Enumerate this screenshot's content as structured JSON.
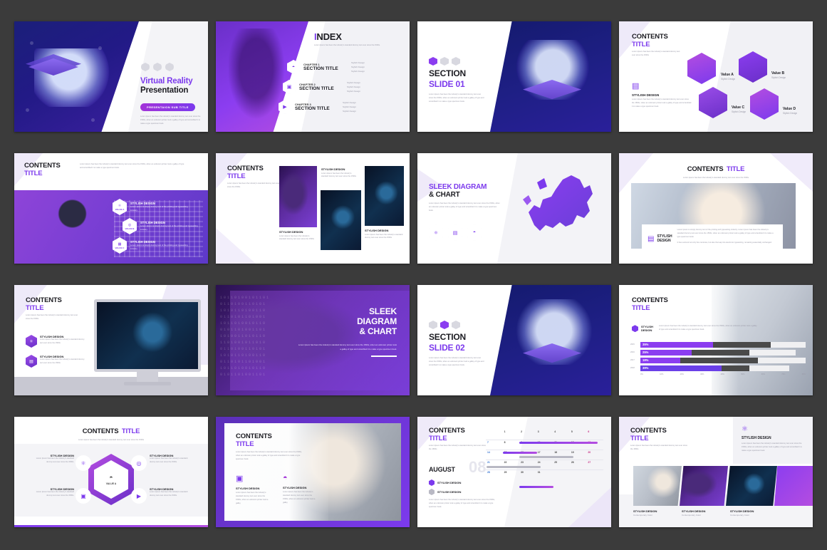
{
  "deck": {
    "theme_colors": {
      "purple": "#7c3aed",
      "violet": "#8b3df0",
      "navy": "#1b1f7a",
      "dark_bg": "#3b3b3b",
      "magenta": "#a233d8"
    },
    "lorem_short": "Lorem Ipsum has been the industry's standard dummy text ever since the 1500s.",
    "lorem_medium": "Lorem Ipsum has been the industry's standard dummy text ever since the 1500s, when an unknown printer took a galley of type and scrambled it to make a type specimen book.",
    "lorem_long": "Lorem Ipsum is simply dummy text of the printing and typesetting industry. Lorem Ipsum has been the industry's standard dummy text ever since the 1500s, when an unknown printer took a galley of type and scrambled it to make a type specimen book.",
    "lorem_extra": "It has survived not only five centuries, but also the leap into electronic typesetting, remaining essentially unchanged.",
    "lorem_tiny": "Lorem Ipsum is simply dummy text of the printing and typesetting industry."
  },
  "slides": [
    {
      "id": 1,
      "name": "title-slide",
      "title_line1": "Virtual Reality",
      "title_line2": "Presentation",
      "badge": "PRESENTAION SUB TITLE",
      "body": "Lorem Ipsum has been the industry's standard dummy text ever since the 1500s, when an unknown printer took a galley of type and scrambled it to make a type specimen book.",
      "icons": [
        "hexagon-icon",
        "vr-headset-icon",
        "gear-icon"
      ]
    },
    {
      "id": 2,
      "name": "index-slide",
      "title": "INDEX",
      "subtitle": "Lorem Ipsum has been the industry's standard dummy text ever since the 1500s.",
      "chapters": [
        {
          "label": "CHAPTER 1",
          "title": "SECTION TITLE",
          "icon": "vr-goggles-icon",
          "bullets": [
            "Stylish Design",
            "Stylish Design",
            "Stylish Design"
          ]
        },
        {
          "label": "CHAPTER 2",
          "title": "SECTION TITLE",
          "icon": "camera-icon",
          "bullets": [
            "Stylish Design",
            "Stylish Design",
            "Stylish Design"
          ]
        },
        {
          "label": "CHAPTER 3",
          "title": "SECTION TITLE",
          "icon": "play-icon",
          "bullets": [
            "Stylish Design",
            "Stylish Design",
            "Stylish Design"
          ]
        }
      ]
    },
    {
      "id": 3,
      "name": "section-slide-01",
      "title_line1": "SECTION",
      "title_line2": "SLIDE 01",
      "body": "Lorem Ipsum has been the industry's standard dummy text ever since the 1500s, when an unknown printer took a galley of type and scrambled it to make a type specimen book.",
      "icons": [
        "vr-headset-icon",
        "hexagon-icon",
        "gear-icon"
      ],
      "active_icon_index": 0
    },
    {
      "id": 4,
      "name": "contents-hex-values",
      "title_line1": "CONTENTS",
      "title_line2": "TITLE",
      "subtitle": "Lorem Ipsum has been the industry's standard dummy text ever since the 1500s",
      "feature_label": "STYLISH DESIGN",
      "feature_icon": "vr-box-icon",
      "feature_body": "Lorem Ipsum has been the industry's standard dummy text ever since the 1500s, when an unknown printer took a galley of type and scrambled it to make a type specimen book.",
      "values": [
        {
          "label": "Value A",
          "sub": "Stylish Design"
        },
        {
          "label": "Value B",
          "sub": "Stylish Design"
        },
        {
          "label": "Value C",
          "sub": "Stylish Design"
        },
        {
          "label": "Value D",
          "sub": "Stylish Design"
        }
      ]
    },
    {
      "id": 5,
      "name": "contents-vr-woman",
      "title_line1": "CONTENTS",
      "title_line2": "TITLE",
      "body": "Lorem Ipsum has been the industry's standard dummy text ever since the 1500s, when an unknown printer took a galley of type and scrambled it to make a type specimen book.",
      "items": [
        {
          "badge": "VALUE A",
          "icon": "atom-icon",
          "title": "STYLISH DESIGN",
          "body": "Lorem Ipsum is simply dummy text of the printing and typesetting industry."
        },
        {
          "badge": "VALUE B",
          "icon": "target-icon",
          "title": "STYLISH DESIGN",
          "body": "Lorem Ipsum is simply dummy text of the printing and typesetting industry."
        },
        {
          "badge": "VALUE C",
          "icon": "image-icon",
          "title": "STYLISH DESIGN",
          "body": "Lorem Ipsum is simply dummy text of the printing and typesetting industry."
        }
      ]
    },
    {
      "id": 6,
      "name": "contents-three-photos",
      "title_line1": "CONTENTS",
      "title_line2": "TITLE",
      "subtitle": "Lorem Ipsum has been the industry's standard dummy text ever since the 1500s",
      "cards": [
        {
          "title": "STYLISH DESIGN",
          "body": "Lorem Ipsum has been the industry's standard dummy text ever since the 1500s"
        },
        {
          "title": "STYLISH DESIGN",
          "body": "Lorem Ipsum has been the industry's standard dummy text ever since the 1500s"
        },
        {
          "title": "STYLISH DESIGN",
          "body": "Lorem Ipsum has been the industry's standard dummy text ever since the 1500s"
        }
      ]
    },
    {
      "id": 7,
      "name": "sleek-diagram-map",
      "title_line1": "SLEEK DIAGRAM",
      "title_line2": "& CHART",
      "body": "Lorem Ipsum has been the industry's standard dummy text ever since the 1500s, when an unknown printer took a galley of type and scrambled it to make a type specimen book.",
      "icons": [
        "atom-icon",
        "document-icon",
        "vr-headset-icon"
      ]
    },
    {
      "id": 8,
      "name": "contents-photo-caption",
      "title_main": "CONTENTS",
      "title_accent": "TITLE",
      "subtitle": "Lorem Ipsum has been the industry's standard dummy text ever since the 1500s",
      "caption_label_line1": "STYLISH",
      "caption_label_line2": "DESIGN",
      "caption_icon": "devices-icon",
      "caption_body": "Lorem Ipsum is simply dummy text of the printing and typesetting industry. Lorem Ipsum has been the industry's standard dummy text ever since the 1500s, when an unknown printer took a galley of type and scrambled it to make a type specimen book.",
      "caption_body2": "It has survived not only five centuries, but also the leap into electronic typesetting, remaining essentially unchanged."
    },
    {
      "id": 9,
      "name": "contents-monitor",
      "title_line1": "CONTENTS",
      "title_line2": "TITLE",
      "subtitle": "Lorem Ipsum has been the industry's standard dummy text ever since the 1500s",
      "items": [
        {
          "icon": "atom-icon",
          "title": "STYLISH DESIGN",
          "body": "Lorem Ipsum has been the industry's standard dummy text ever since the 1500s"
        },
        {
          "icon": "devices-icon",
          "title": "STYLISH DESIGN",
          "body": "Lorem Ipsum has been the industry's standard dummy text ever since the 1500s"
        }
      ]
    },
    {
      "id": 10,
      "name": "sleek-diagram-right",
      "title_line1": "SLEEK",
      "title_line2": "DIAGRAM",
      "title_line3": "& CHART",
      "body": "Lorem Ipsum has been the industry's standard dummy text ever since the 1500s, when an unknown printer took a galley of type and scrambled it to make a type specimen book."
    },
    {
      "id": 11,
      "name": "section-slide-02",
      "title_line1": "SECTION",
      "title_line2": "SLIDE 02",
      "body": "Lorem Ipsum has been the industry's standard dummy text ever since the 1500s, when an unknown printer took a galley of type and scrambled it to make a type specimen book.",
      "icons": [
        "gear-icon",
        "vr-headset-icon",
        "hexagon-icon"
      ],
      "active_icon_index": 1
    },
    {
      "id": 12,
      "name": "contents-bar-chart",
      "title_line1": "CONTENTS",
      "title_line2": "TITLE",
      "legend_label_line1": "STYLISH",
      "legend_label_line2": "DESIGN",
      "body": "Lorem Ipsum has been the industry's standard dummy text ever since the 1500s, when an unknown printer took a galley of type and scrambled it to make a type specimen book.",
      "chart_data": {
        "type": "bar",
        "orientation": "horizontal",
        "title": "",
        "xlabel": "",
        "ylabel": "",
        "xlim": [
          0,
          80
        ],
        "grid": false,
        "categories": [
          "2015",
          "2016",
          "2017",
          "2018"
        ],
        "tick_labels": [
          "0%",
          "10%",
          "20%",
          "30%",
          "40%",
          "50%",
          "60%",
          "70%",
          "80%"
        ],
        "series": [
          {
            "name": "Series 1",
            "color": "#8b3df0",
            "values": [
              35,
              25,
              19,
              39
            ],
            "labels": [
              "35%",
              "25%",
              "19%",
              "39%"
            ]
          },
          {
            "name": "Series 2",
            "color": "#4a4a4a",
            "values": [
              63,
              53,
              57,
              53
            ]
          },
          {
            "name": "Series 3",
            "color": "#f0f0f2",
            "values": [
              80,
              75,
              80,
              72
            ]
          }
        ]
      }
    },
    {
      "id": 13,
      "name": "contents-hex-diagram",
      "title_main": "CONTENTS",
      "title_accent": "TITLE",
      "subtitle": "Lorem Ipsum has been the industry's standard dummy text ever since the 1500s",
      "center_label": "VALUE A",
      "center_icon": "vr-headset-icon",
      "items": [
        {
          "icon": "atom-icon",
          "title": "STYLISH DESIGN",
          "body": "Lorem Ipsum has been the industry's standard dummy text ever since the 1500s."
        },
        {
          "icon": "target-icon",
          "title": "STYLISH DESIGN",
          "body": "Lorem Ipsum has been the industry's standard dummy text ever since the 1500s."
        },
        {
          "icon": "camera-icon",
          "title": "STYLISH DESIGN",
          "body": "Lorem Ipsum has been the industry's standard dummy text ever since the 1500s."
        },
        {
          "icon": "play-icon",
          "title": "STYLISH DESIGN",
          "body": "Lorem Ipsum has been the industry's standard dummy text ever since the 1500s."
        }
      ]
    },
    {
      "id": 14,
      "name": "contents-man-vr",
      "title_line1": "CONTENTS",
      "title_line2": "TITLE",
      "body": "Lorem Ipsum has been the industry's standard dummy text ever since the 1500s, when an unknown printer took a galley of type and scrambled it to make a type specimen book.",
      "items": [
        {
          "icon": "robot-icon",
          "title": "STYLISH DESIGN",
          "body": "Lorem Ipsum has been the industry's standard dummy text ever since the 1500s, when an unknown printer took a galley"
        },
        {
          "icon": "vr-headset-icon",
          "title": "STYLISH DESIGN",
          "body": "Lorem Ipsum has been the industry's standard dummy text ever since the 1500s, when an unknown printer took a galley"
        }
      ]
    },
    {
      "id": 15,
      "name": "contents-calendar",
      "title_line1": "CONTENTS",
      "title_line2": "TITLE",
      "subtitle": "Lorem Ipsum has been the industry's standard dummy text ever since the 1500s",
      "month": "AUGUST",
      "month_number": "08",
      "legend": [
        {
          "color": "#7c3aed",
          "label": "STYLISH DESIGN"
        },
        {
          "color": "#b9b9c4",
          "label": "STYLISH DESIGN"
        }
      ],
      "body": "Lorem Ipsum has been the industry's standard dummy text ever since the 1500s, when an unknown printer took a galley of type and scrambled it to make a type specimen book.",
      "weeks": [
        [
          "",
          "1",
          "2",
          "3",
          "4",
          "5",
          "6"
        ],
        [
          "7",
          "8",
          "9",
          "10",
          "11",
          "12",
          "13"
        ],
        [
          "14",
          "15",
          "16",
          "17",
          "18",
          "19",
          "20"
        ],
        [
          "21",
          "22",
          "23",
          "24",
          "25",
          "26",
          "27"
        ],
        [
          "28",
          "29",
          "30",
          "31",
          "",
          "",
          ""
        ]
      ]
    },
    {
      "id": 16,
      "name": "contents-photo-strip",
      "title_line1": "CONTENTS",
      "title_line2": "TITLE",
      "subtitle": "Lorem Ipsum has been the industry's standard dummy text ever since the 1500s",
      "feature_icon": "atom-icon",
      "feature_title": "STYLISH DESIGN",
      "feature_body": "Lorem Ipsum has been the industry's standard dummy text ever since the 1500s, when an unknown printer took a gallery of type and scrambled it to make a type specimen book.",
      "captions": [
        {
          "title": "STYLISH DESIGN",
          "sub": "Contemporary Color"
        },
        {
          "title": "STYLISH DESIGN",
          "sub": "Contemporary Color"
        },
        {
          "title": "STYLISH DESIGN",
          "sub": "Contemporary Color"
        }
      ]
    }
  ]
}
